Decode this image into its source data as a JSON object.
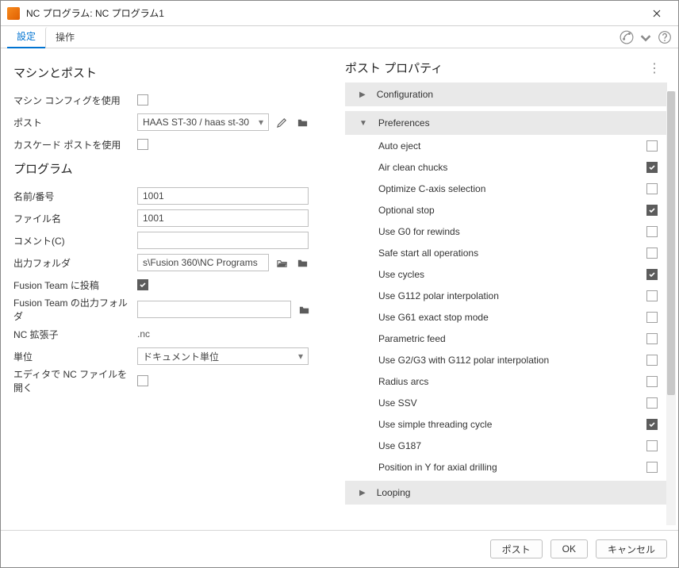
{
  "window": {
    "title": "NC プログラム: NC プログラム1"
  },
  "tabs": {
    "settings": "設定",
    "operations": "操作"
  },
  "left": {
    "section_machine": "マシンとポスト",
    "use_machine_config": {
      "label": "マシン コンフィグを使用",
      "checked": false
    },
    "post": {
      "label": "ポスト",
      "value": "HAAS ST-30 / haas st-30"
    },
    "use_cascade_post": {
      "label": "カスケード ポストを使用",
      "checked": false
    },
    "section_program": "プログラム",
    "name_number": {
      "label": "名前/番号",
      "value": "1001"
    },
    "file_name": {
      "label": "ファイル名",
      "value": "1001"
    },
    "comment": {
      "label": "コメント(C)",
      "value": ""
    },
    "output_folder": {
      "label": "出力フォルダ",
      "value": "s\\Fusion 360\\NC Programs"
    },
    "fusion_team_post": {
      "label": "Fusion Team に投稿",
      "checked": true
    },
    "fusion_team_output_folder": {
      "label": "Fusion Team の出力フォルダ",
      "value": ""
    },
    "nc_extension": {
      "label": "NC 拡張子",
      "value": ".nc"
    },
    "unit": {
      "label": "単位",
      "value": "ドキュメント単位"
    },
    "open_in_editor": {
      "label": "エディタで NC ファイルを開く",
      "checked": false
    }
  },
  "right": {
    "title": "ポスト プロパティ",
    "groups": {
      "configuration": "Configuration",
      "preferences": "Preferences",
      "looping": "Looping"
    },
    "prefs": [
      {
        "label": "Auto eject",
        "checked": false
      },
      {
        "label": "Air clean chucks",
        "checked": true
      },
      {
        "label": "Optimize C-axis selection",
        "checked": false
      },
      {
        "label": "Optional stop",
        "checked": true
      },
      {
        "label": "Use G0 for rewinds",
        "checked": false
      },
      {
        "label": "Safe start all operations",
        "checked": false
      },
      {
        "label": "Use cycles",
        "checked": true
      },
      {
        "label": "Use G112 polar interpolation",
        "checked": false
      },
      {
        "label": "Use G61 exact stop mode",
        "checked": false
      },
      {
        "label": "Parametric feed",
        "checked": false
      },
      {
        "label": "Use G2/G3 with G112 polar interpolation",
        "checked": false
      },
      {
        "label": "Radius arcs",
        "checked": false
      },
      {
        "label": "Use SSV",
        "checked": false
      },
      {
        "label": "Use simple threading cycle",
        "checked": true
      },
      {
        "label": "Use G187",
        "checked": false
      },
      {
        "label": "Position in Y for axial drilling",
        "checked": false
      }
    ]
  },
  "footer": {
    "post": "ポスト",
    "ok": "OK",
    "cancel": "キャンセル"
  }
}
